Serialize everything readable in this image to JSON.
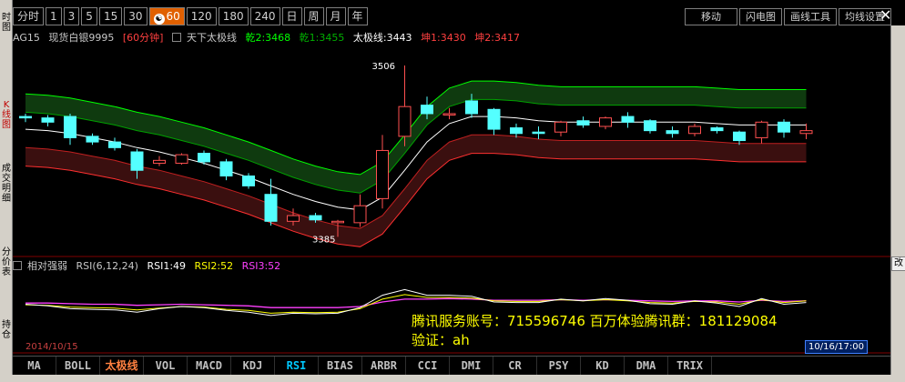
{
  "toolbar": {
    "periods": [
      {
        "label": "分时",
        "active": false
      },
      {
        "label": "1",
        "active": false
      },
      {
        "label": "3",
        "active": false
      },
      {
        "label": "5",
        "active": false
      },
      {
        "label": "15",
        "active": false
      },
      {
        "label": "30",
        "active": false
      },
      {
        "label": "60",
        "active": true
      },
      {
        "label": "120",
        "active": false
      },
      {
        "label": "180",
        "active": false
      },
      {
        "label": "240",
        "active": false
      },
      {
        "label": "日",
        "active": false
      },
      {
        "label": "周",
        "active": false
      },
      {
        "label": "月",
        "active": false
      },
      {
        "label": "年",
        "active": false
      }
    ],
    "right_tools": [
      "移动",
      "闪电图",
      "画线工具",
      "均线设置"
    ]
  },
  "left_strip": {
    "labels": [
      "时图",
      "K线图",
      "成交明细",
      "分价表",
      "持仓"
    ]
  },
  "right_strip": {
    "tab": "改"
  },
  "info": {
    "symbol": "AG15",
    "name": "现货白银9995",
    "period": "[60分钟]",
    "indicator_name": "天下太极线",
    "qian2_label": "乾2:3468",
    "qian1_label": "乾1:3455",
    "taiji_label": "太极线:3443",
    "kun1_label": "坤1:3430",
    "kun2_label": "坤2:3417",
    "colors": {
      "qian2": "#00ff00",
      "qian1": "#00c000",
      "taiji": "#ffffff",
      "kun1": "#ff4040",
      "kun2": "#ff4040"
    }
  },
  "rsi": {
    "name": "相对强弱",
    "params": "RSI(6,12,24)",
    "rsi1_label": "RSI1:49",
    "rsi2_label": "RSI2:52",
    "rsi3_label": "RSI3:52"
  },
  "promo": {
    "line1": "腾讯服务账号：715596746 百万体验腾讯群：181129084",
    "line2": "验证：ah"
  },
  "dates": {
    "left": "2014/10/15",
    "right": "10/16/17:00"
  },
  "indicator_tabs": [
    {
      "label": "MA",
      "state": "normal"
    },
    {
      "label": "BOLL",
      "state": "normal"
    },
    {
      "label": "太极线",
      "state": "taiji"
    },
    {
      "label": "VOL",
      "state": "normal"
    },
    {
      "label": "MACD",
      "state": "normal"
    },
    {
      "label": "KDJ",
      "state": "normal"
    },
    {
      "label": "RSI",
      "state": "active"
    },
    {
      "label": "BIAS",
      "state": "normal"
    },
    {
      "label": "ARBR",
      "state": "normal"
    },
    {
      "label": "CCI",
      "state": "normal"
    },
    {
      "label": "DMI",
      "state": "normal"
    },
    {
      "label": "CR",
      "state": "normal"
    },
    {
      "label": "PSY",
      "state": "normal"
    },
    {
      "label": "KD",
      "state": "normal"
    },
    {
      "label": "DMA",
      "state": "normal"
    },
    {
      "label": "TRIX",
      "state": "normal"
    }
  ],
  "chart_data": {
    "type": "candlestick",
    "title": "现货白银9995 [60分钟]",
    "annotations": {
      "high": "3506",
      "low": "3385"
    },
    "y_range": [
      3375,
      3515
    ],
    "candles": [
      {
        "o": 3470,
        "c": 3469,
        "h": 3472,
        "l": 3466
      },
      {
        "o": 3469,
        "c": 3466,
        "h": 3471,
        "l": 3463
      },
      {
        "o": 3470,
        "c": 3455,
        "h": 3472,
        "l": 3450
      },
      {
        "o": 3456,
        "c": 3452,
        "h": 3458,
        "l": 3450
      },
      {
        "o": 3452,
        "c": 3448,
        "h": 3455,
        "l": 3446
      },
      {
        "o": 3445,
        "c": 3432,
        "h": 3447,
        "l": 3426
      },
      {
        "o": 3437,
        "c": 3439,
        "h": 3442,
        "l": 3435
      },
      {
        "o": 3437,
        "c": 3443,
        "h": 3444,
        "l": 3436
      },
      {
        "o": 3444,
        "c": 3438,
        "h": 3446,
        "l": 3436
      },
      {
        "o": 3438,
        "c": 3428,
        "h": 3440,
        "l": 3425
      },
      {
        "o": 3428,
        "c": 3421,
        "h": 3430,
        "l": 3419
      },
      {
        "o": 3415,
        "c": 3396,
        "h": 3426,
        "l": 3393
      },
      {
        "o": 3396,
        "c": 3400,
        "h": 3405,
        "l": 3393
      },
      {
        "o": 3400,
        "c": 3397,
        "h": 3402,
        "l": 3395
      },
      {
        "o": 3395,
        "c": 3396,
        "h": 3397,
        "l": 3385
      },
      {
        "o": 3395,
        "c": 3407,
        "h": 3415,
        "l": 3392
      },
      {
        "o": 3412,
        "c": 3446,
        "h": 3457,
        "l": 3405
      },
      {
        "o": 3456,
        "c": 3477,
        "h": 3506,
        "l": 3449
      },
      {
        "o": 3478,
        "c": 3472,
        "h": 3484,
        "l": 3468
      },
      {
        "o": 3472,
        "c": 3472,
        "h": 3476,
        "l": 3468
      },
      {
        "o": 3481,
        "c": 3472,
        "h": 3486,
        "l": 3469
      },
      {
        "o": 3475,
        "c": 3461,
        "h": 3476,
        "l": 3457
      },
      {
        "o": 3462,
        "c": 3458,
        "h": 3465,
        "l": 3455
      },
      {
        "o": 3459,
        "c": 3458,
        "h": 3463,
        "l": 3454
      },
      {
        "o": 3459,
        "c": 3466,
        "h": 3467,
        "l": 3456
      },
      {
        "o": 3467,
        "c": 3464,
        "h": 3470,
        "l": 3462
      },
      {
        "o": 3463,
        "c": 3469,
        "h": 3470,
        "l": 3461
      },
      {
        "o": 3470,
        "c": 3466,
        "h": 3473,
        "l": 3462
      },
      {
        "o": 3467,
        "c": 3460,
        "h": 3468,
        "l": 3458
      },
      {
        "o": 3460,
        "c": 3458,
        "h": 3463,
        "l": 3455
      },
      {
        "o": 3458,
        "c": 3463,
        "h": 3465,
        "l": 3456
      },
      {
        "o": 3462,
        "c": 3460,
        "h": 3463,
        "l": 3458
      },
      {
        "o": 3459,
        "c": 3453,
        "h": 3460,
        "l": 3450
      },
      {
        "o": 3455,
        "c": 3466,
        "h": 3467,
        "l": 3451
      },
      {
        "o": 3466,
        "c": 3459,
        "h": 3468,
        "l": 3455
      },
      {
        "o": 3458,
        "c": 3460,
        "h": 3465,
        "l": 3454
      }
    ],
    "band_taiji": [
      3461,
      3460,
      3458,
      3455,
      3452,
      3448,
      3445,
      3441,
      3437,
      3432,
      3427,
      3421,
      3415,
      3410,
      3406,
      3404,
      3413,
      3432,
      3452,
      3465,
      3470,
      3470,
      3469,
      3467,
      3466,
      3466,
      3466,
      3466,
      3466,
      3466,
      3466,
      3465,
      3464,
      3464,
      3464,
      3464
    ],
    "band_offsets": {
      "qian2": 25,
      "qian1": 12,
      "kun1": -13,
      "kun2": -26
    },
    "rsi_series": {
      "rsi1": [
        46,
        43,
        38,
        37,
        36,
        32,
        38,
        42,
        40,
        35,
        32,
        26,
        30,
        29,
        30,
        40,
        62,
        72,
        62,
        62,
        60,
        50,
        49,
        49,
        55,
        52,
        56,
        53,
        47,
        46,
        52,
        48,
        42,
        56,
        46,
        49
      ],
      "rsi2": [
        45,
        44,
        41,
        40,
        39,
        36,
        39,
        42,
        41,
        37,
        35,
        30,
        32,
        31,
        32,
        38,
        55,
        63,
        58,
        58,
        57,
        52,
        51,
        51,
        54,
        52,
        54,
        52,
        49,
        48,
        51,
        50,
        46,
        54,
        49,
        52
      ],
      "rsi3": [
        48,
        48,
        47,
        46,
        46,
        44,
        45,
        46,
        45,
        44,
        43,
        40,
        40,
        40,
        40,
        42,
        50,
        55,
        55,
        56,
        55,
        53,
        53,
        53,
        54,
        53,
        54,
        53,
        52,
        51,
        52,
        52,
        50,
        53,
        51,
        52
      ]
    }
  }
}
